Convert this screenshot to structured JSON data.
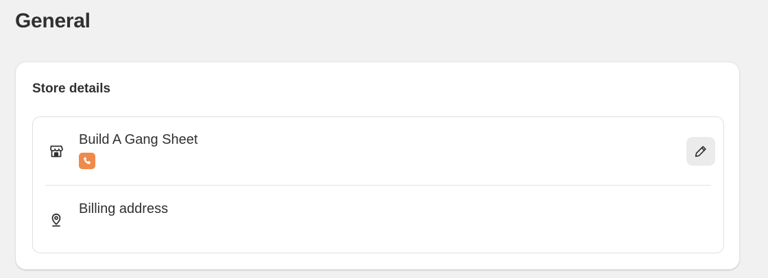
{
  "page": {
    "title": "General"
  },
  "store_details": {
    "title": "Store details",
    "store": {
      "name": "Build A Gang Sheet",
      "icon": "store-icon",
      "badge_icon": "phone-icon",
      "badge_color": "#f08a4b",
      "edit_icon": "pencil-icon"
    },
    "billing": {
      "label": "Billing address",
      "icon": "location-pin-icon"
    }
  }
}
